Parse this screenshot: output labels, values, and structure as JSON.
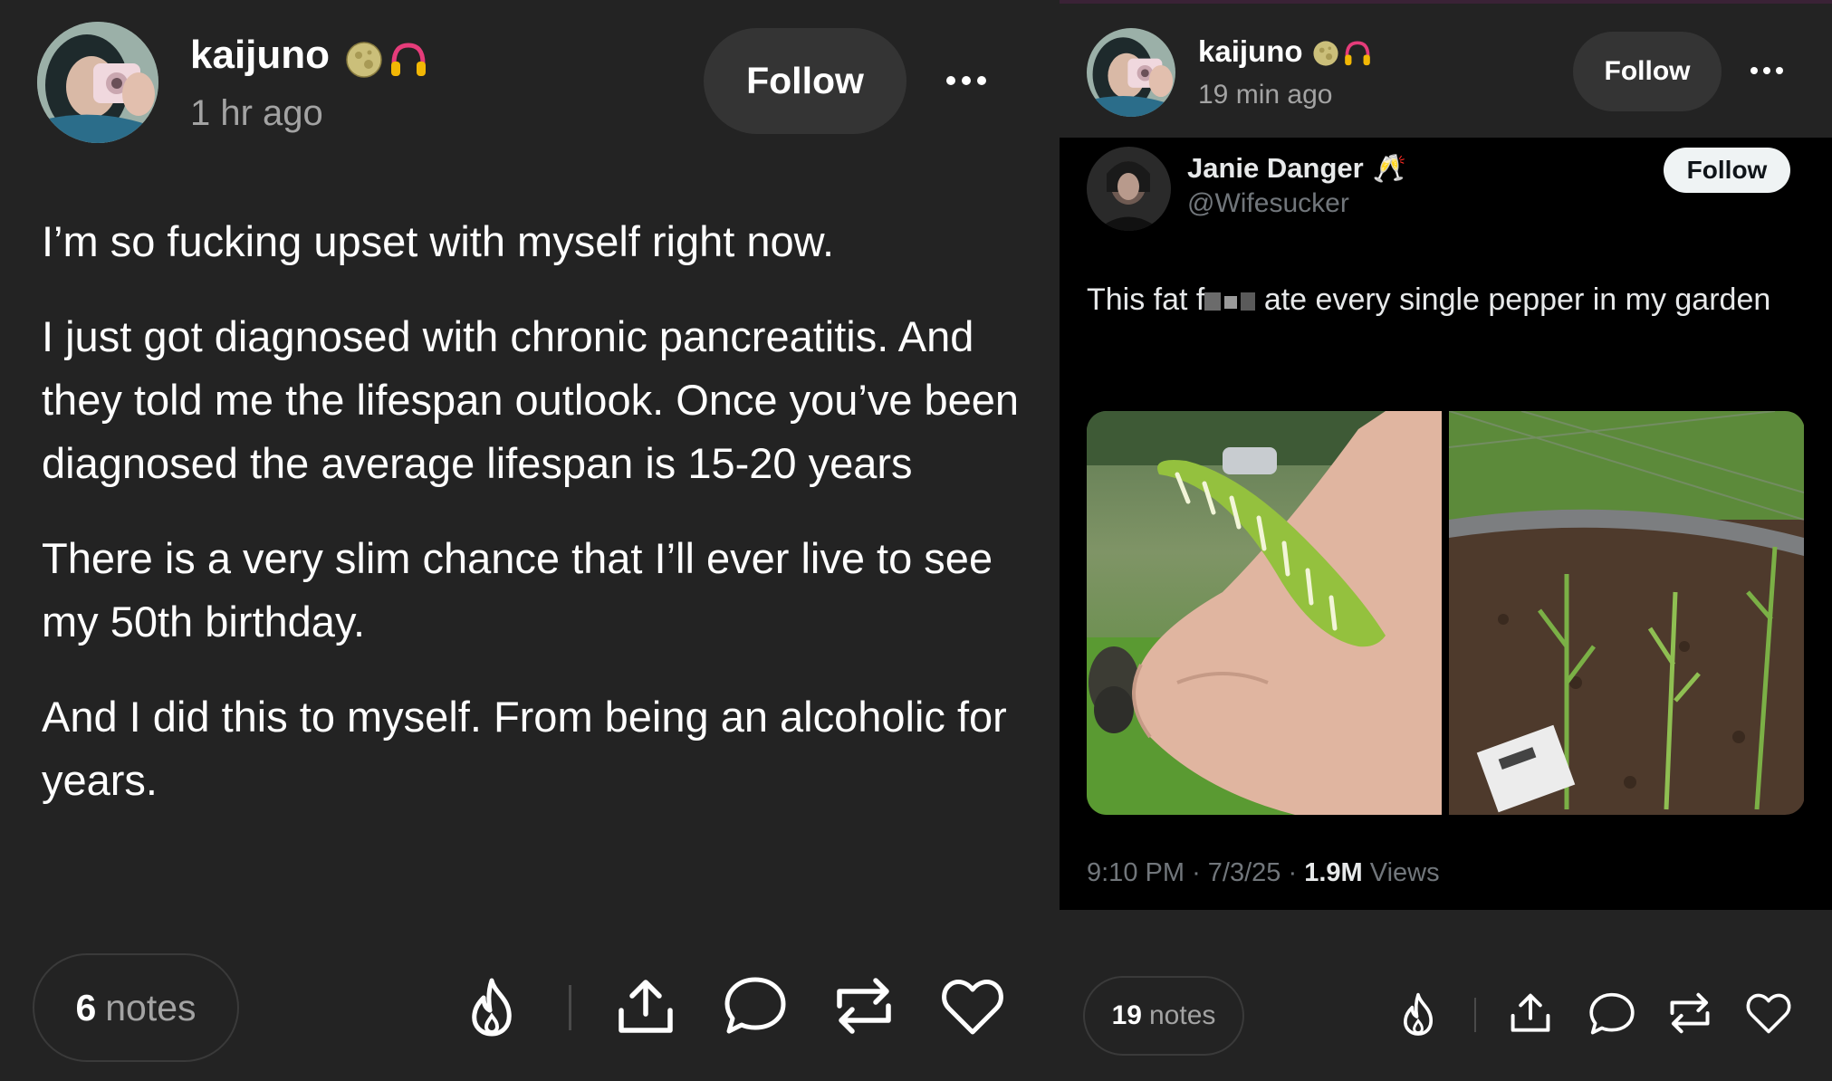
{
  "left_post": {
    "username": "kaijuno",
    "timestamp": "1 hr ago",
    "follow_label": "Follow",
    "paragraphs": [
      "I’m so fucking upset with myself right now.",
      "I just got diagnosed with chronic pancreatitis. And they told me the lifespan outlook. Once you’ve been diagnosed the average lifespan is 15-20 years",
      "There is a very slim chance that I’ll ever live to see my 50th birthday.",
      "And I did this to myself. From being an alcoholic for years."
    ],
    "notes_count": "6",
    "notes_label": "notes",
    "badges": [
      "moon-icon",
      "headphones-icon"
    ]
  },
  "right_post": {
    "username": "kaijuno",
    "timestamp": "19 min ago",
    "follow_label": "Follow",
    "notes_count": "19",
    "notes_label": "notes",
    "tweet": {
      "name": "Janie Danger",
      "name_emoji": "🥂",
      "handle": "@Wifesucker",
      "follow_label": "Follow",
      "text_before": "This fat f",
      "text_after": " ate every single pepper in my garden",
      "time": "9:10 PM",
      "date": "7/3/25",
      "views_count": "1.9M",
      "views_label": "Views",
      "separator": "·",
      "images": [
        "hornworm-caterpillar-photo",
        "eaten-pepper-plants-photo"
      ]
    }
  },
  "icons": [
    "flame-icon",
    "share-icon",
    "comment-icon",
    "reblog-icon",
    "heart-icon",
    "more-icon"
  ],
  "colors": {
    "background": "#232323",
    "muted_text": "#a3a3a3",
    "follow_button": "#343434",
    "tweet_background": "#000000"
  }
}
